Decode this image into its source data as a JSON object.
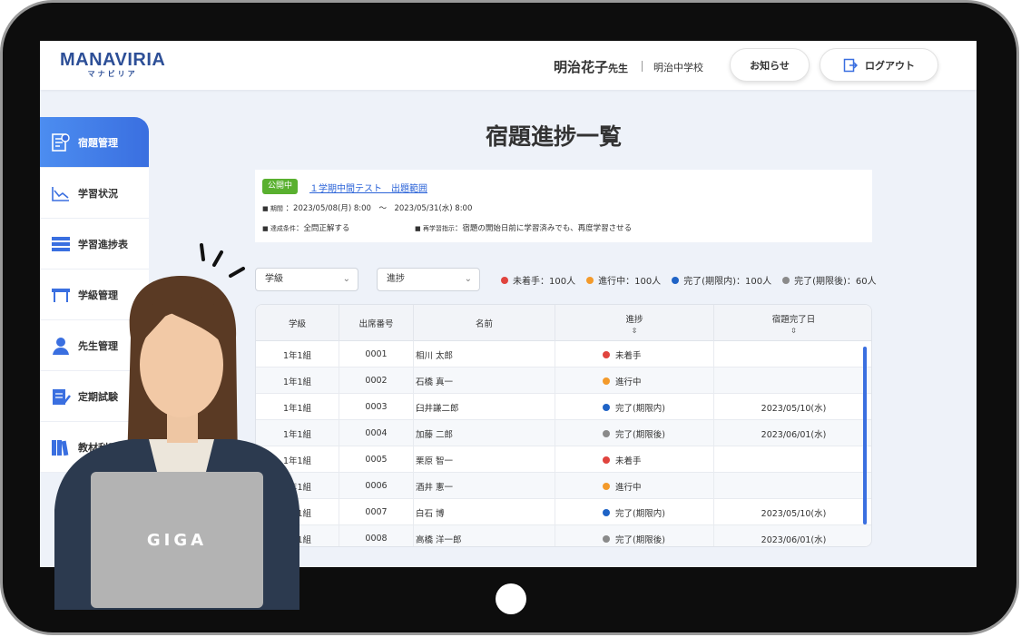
{
  "header": {
    "logo": "MANAVIRIA",
    "logo_sub": "マナビリア",
    "teacher_name": "明治花子",
    "teacher_suffix": "先生",
    "school": "明治中学校",
    "notice_label": "お知らせ",
    "logout_label": "ログアウト"
  },
  "sidebar": {
    "items": [
      {
        "label": "宿題管理",
        "icon": "homework-icon",
        "active": true
      },
      {
        "label": "学習状況",
        "icon": "chart-icon",
        "active": false
      },
      {
        "label": "学習進捗表",
        "icon": "progress-table-icon",
        "active": false
      },
      {
        "label": "学級管理",
        "icon": "class-icon",
        "active": false
      },
      {
        "label": "先生管理",
        "icon": "teacher-icon",
        "active": false
      },
      {
        "label": "定期試験",
        "icon": "exam-icon",
        "active": false
      },
      {
        "label": "教材利用",
        "icon": "books-icon",
        "active": false
      }
    ]
  },
  "main": {
    "title": "宿題進捗一覧",
    "info": {
      "badge": "公開中",
      "link": "１学期中間テスト　出題範囲",
      "period_label": "■ 期間",
      "period_value": "：2023/05/08(月) 8:00　～　2023/05/31(水) 8:00",
      "condition_label": "■ 達成条件",
      "condition_value": "：全問正解する",
      "relearn_label": "■ 再学習指示",
      "relearn_value": "：宿題の開始日前に学習済みでも、再度学習させる"
    },
    "filters": {
      "class_select": "学級",
      "progress_select": "進捗"
    },
    "legend": [
      {
        "label": "未着手：100人",
        "color": "#e0443e"
      },
      {
        "label": "進行中：100人",
        "color": "#f39a2b"
      },
      {
        "label": "完了(期限内)：100人",
        "color": "#1f63c6"
      },
      {
        "label": "完了(期限後)：60人",
        "color": "#8a8a8a"
      }
    ],
    "table": {
      "headers": {
        "class": "学級",
        "number": "出席番号",
        "name": "名前",
        "progress": "進捗",
        "date": "宿題完了日"
      },
      "rows": [
        {
          "class": "1年1組",
          "number": "0001",
          "name": "相川 太郎",
          "progress": "未着手",
          "color": "#e0443e",
          "date": ""
        },
        {
          "class": "1年1組",
          "number": "0002",
          "name": "石橋 真一",
          "progress": "進行中",
          "color": "#f39a2b",
          "date": ""
        },
        {
          "class": "1年1組",
          "number": "0003",
          "name": "臼井謙二郎",
          "progress": "完了(期限内)",
          "color": "#1f63c6",
          "date": "2023/05/10(水)"
        },
        {
          "class": "1年1組",
          "number": "0004",
          "name": "加藤 二郎",
          "progress": "完了(期限後)",
          "color": "#8a8a8a",
          "date": "2023/06/01(水)"
        },
        {
          "class": "1年1組",
          "number": "0005",
          "name": "栗原 智一",
          "progress": "未着手",
          "color": "#e0443e",
          "date": ""
        },
        {
          "class": "1年1組",
          "number": "0006",
          "name": "酒井 憲一",
          "progress": "進行中",
          "color": "#f39a2b",
          "date": ""
        },
        {
          "class": "1年1組",
          "number": "0007",
          "name": "白石 博",
          "progress": "完了(期限内)",
          "color": "#1f63c6",
          "date": "2023/05/10(水)"
        },
        {
          "class": "1年1組",
          "number": "0008",
          "name": "高橋 洋一郎",
          "progress": "完了(期限後)",
          "color": "#8a8a8a",
          "date": "2023/06/01(水)"
        }
      ]
    }
  },
  "overlay": {
    "laptop_label": "GIGA"
  }
}
